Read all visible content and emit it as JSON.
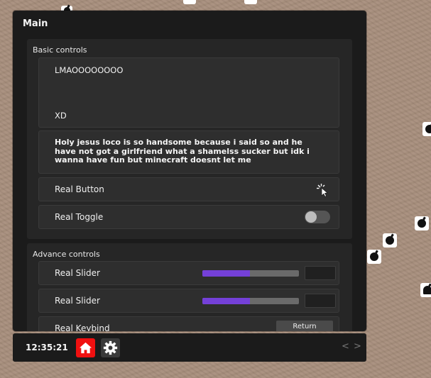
{
  "window": {
    "title": "Main"
  },
  "basic": {
    "title": "Basic controls",
    "label_lines": [
      "LMAOOOOOOOO",
      "XD"
    ],
    "paragraph": "Holy jesus loco is so handsome because i said so and he have not got a girlfriend what a shamelss sucker but idk i wanna have fun but minecraft doesnt let me",
    "button_label": "Real Button",
    "toggle_label": "Real Toggle",
    "toggle_on": false
  },
  "advance": {
    "title": "Advance controls",
    "sliders": [
      {
        "label": "Real Slider",
        "fill": 0.49,
        "value": ""
      },
      {
        "label": "Real Slider",
        "fill": 0.49,
        "value": ""
      }
    ],
    "keybind_label": "Real Keybind",
    "keybind_value": "Return"
  },
  "bottombar": {
    "clock": "12:35:21",
    "prev": "<",
    "next": ">"
  },
  "colors": {
    "accent": "#7440d8",
    "home": "#f01010",
    "panel": "#1b1b1b"
  }
}
